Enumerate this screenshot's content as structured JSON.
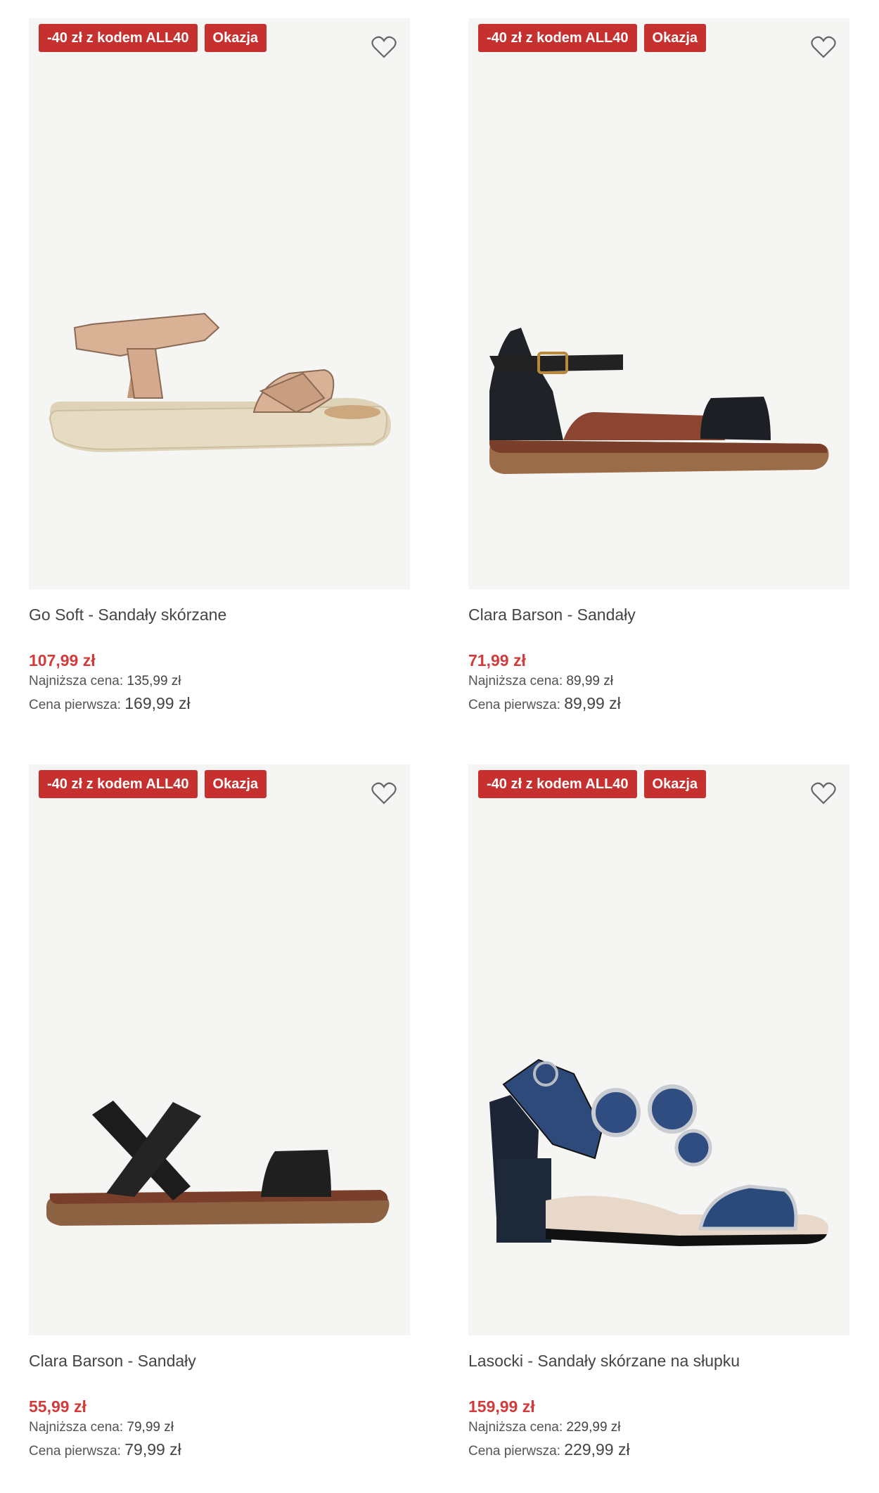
{
  "colors": {
    "badge": "#c6302e",
    "price": "#d23b3b",
    "image_bg": "#f5f5f4"
  },
  "products": [
    {
      "badge_code": "-40 zł z kodem ALL40",
      "badge_deal": "Okazja",
      "fav_icon": "heart-outline-icon",
      "name": "Go Soft - Sandały skórzane",
      "price": "107,99 zł",
      "lowest_label": "Najniższa cena:",
      "lowest_value": "135,99 zł",
      "first_label": "Cena pierwsza:",
      "first_value": "169,99 zł"
    },
    {
      "badge_code": "-40 zł z kodem ALL40",
      "badge_deal": "Okazja",
      "fav_icon": "heart-outline-icon",
      "name": "Clara Barson - Sandały",
      "price": "71,99 zł",
      "lowest_label": "Najniższa cena:",
      "lowest_value": "89,99 zł",
      "first_label": "Cena pierwsza:",
      "first_value": "89,99 zł"
    },
    {
      "badge_code": "-40 zł z kodem ALL40",
      "badge_deal": "Okazja",
      "fav_icon": "heart-outline-icon",
      "name": "Clara Barson - Sandały",
      "price": "55,99 zł",
      "lowest_label": "Najniższa cena:",
      "lowest_value": "79,99 zł",
      "first_label": "Cena pierwsza:",
      "first_value": "79,99 zł"
    },
    {
      "badge_code": "-40 zł z kodem ALL40",
      "badge_deal": "Okazja",
      "fav_icon": "heart-outline-icon",
      "name": "Lasocki - Sandały skórzane na słupku",
      "price": "159,99 zł",
      "lowest_label": "Najniższa cena:",
      "lowest_value": "229,99 zł",
      "first_label": "Cena pierwsza:",
      "first_value": "229,99 zł"
    }
  ]
}
